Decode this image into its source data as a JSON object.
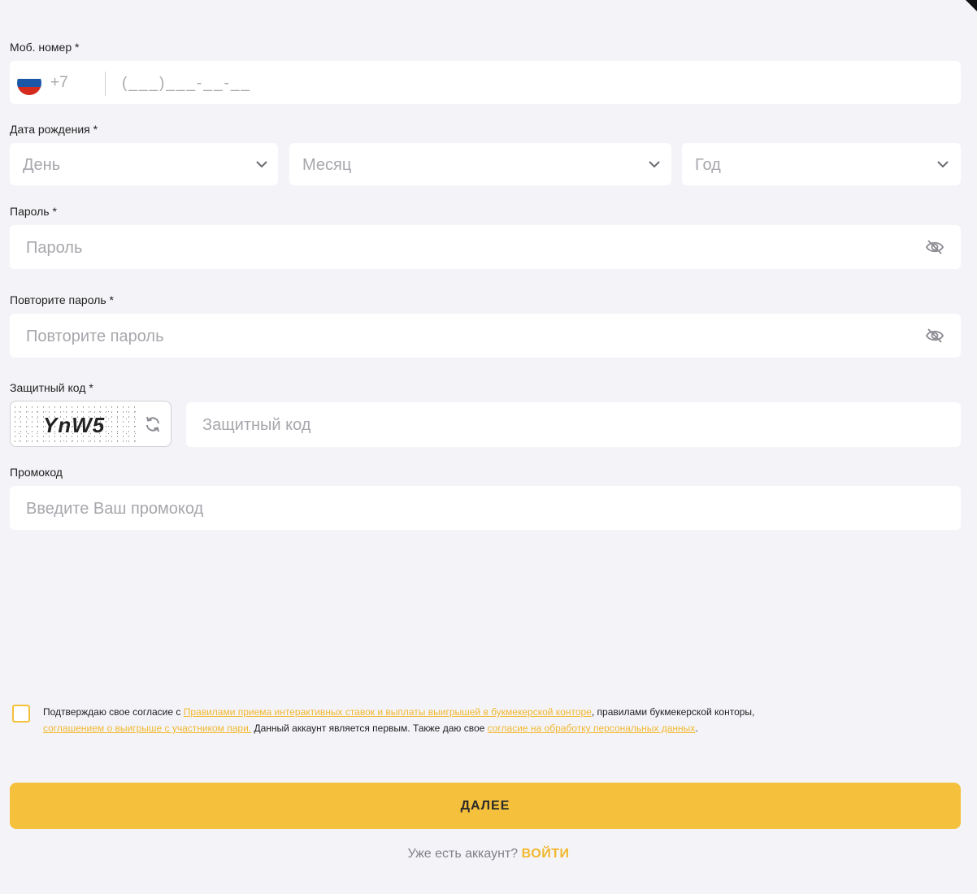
{
  "phone": {
    "label": "Моб. номер *",
    "country_code": "+7",
    "placeholder": "(___)___-__-__",
    "flag_colors": [
      "#ffffff",
      "#1c57a7",
      "#d52b1e"
    ]
  },
  "birthdate": {
    "label": "Дата рождения *",
    "day_placeholder": "День",
    "month_placeholder": "Месяц",
    "year_placeholder": "Год"
  },
  "password": {
    "label": "Пароль *",
    "placeholder": "Пароль"
  },
  "repeat_password": {
    "label": "Повторите пароль *",
    "placeholder": "Повторите пароль"
  },
  "captcha": {
    "label": "Защитный код *",
    "code": "YnW5",
    "placeholder": "Защитный код"
  },
  "promo": {
    "label": "Промокод",
    "placeholder": "Введите Ваш промокод"
  },
  "consent": {
    "text_1": "Подтверждаю свое согласие с ",
    "link_1": "Правилами приема интерактивных ставок и выплаты выигрышей в букмекерской конторе",
    "text_2": ", правилами букмекерской конторы,",
    "link_2": "соглашением о выигрыше с участником пари.",
    "text_3": " Данный аккаунт является первым. Также даю свое ",
    "link_3": "согласие на обработку персональных данных",
    "text_4": "."
  },
  "submit": {
    "label": "ДАЛЕЕ"
  },
  "login": {
    "question": "Уже есть аккаунт?",
    "link": "ВОЙТИ"
  },
  "colors": {
    "accent": "#f5c03b",
    "link": "#f2b72f",
    "background": "#f4f4f8",
    "field": "#ffffff"
  }
}
